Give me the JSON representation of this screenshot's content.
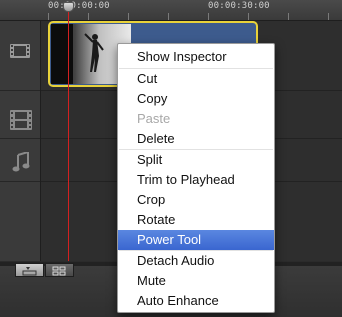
{
  "ruler": {
    "timecodes": [
      "00:00:00:00",
      "00:00:30:00"
    ]
  },
  "context_menu": {
    "items": [
      {
        "label": "Show Inspector",
        "enabled": true
      },
      {
        "label": "Cut",
        "enabled": true
      },
      {
        "label": "Copy",
        "enabled": true
      },
      {
        "label": "Paste",
        "enabled": false
      },
      {
        "label": "Delete",
        "enabled": true
      },
      {
        "label": "Split",
        "enabled": true
      },
      {
        "label": "Trim to Playhead",
        "enabled": true
      },
      {
        "label": "Crop",
        "enabled": true
      },
      {
        "label": "Rotate",
        "enabled": true
      },
      {
        "label": "Power Tool",
        "enabled": true,
        "highlighted": true
      },
      {
        "label": "Detach Audio",
        "enabled": true
      },
      {
        "label": "Mute",
        "enabled": true
      },
      {
        "label": "Auto Enhance",
        "enabled": true
      }
    ]
  },
  "colors": {
    "selection_border": "#e8d23a",
    "playhead": "#d42020",
    "menu_highlight": "#3f6fd6",
    "clip_fill": "#3d5b8d"
  },
  "icons": {
    "video_track": "film-strip-icon",
    "title_track": "film-grid-icon",
    "audio_track": "music-note-icon",
    "view_filmstrip": "filmstrip-view-icon",
    "view_grid": "grid-view-icon"
  }
}
